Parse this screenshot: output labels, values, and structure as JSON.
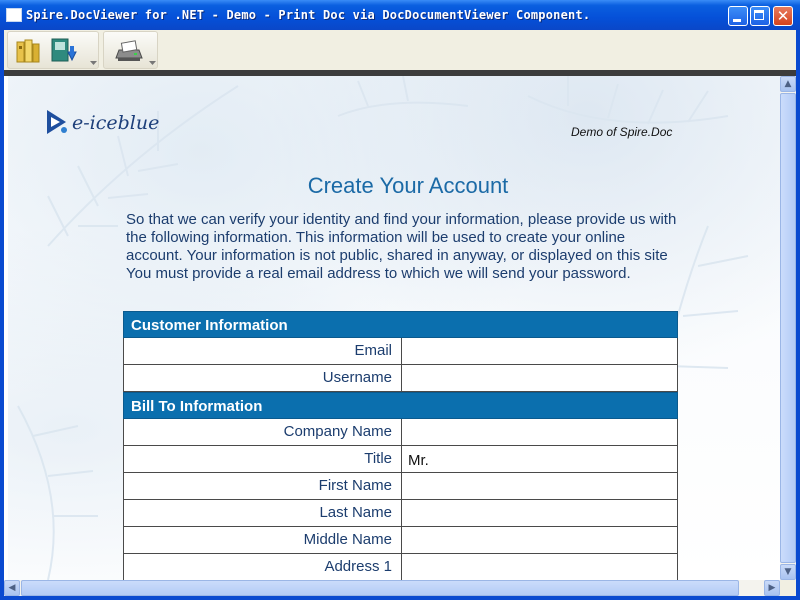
{
  "window": {
    "title": "Spire.DocViewer for .NET - Demo - Print Doc via DocDocumentViewer Component."
  },
  "toolbar": {
    "icons": [
      "open-file-icon",
      "save-icon",
      "print-icon"
    ]
  },
  "document": {
    "logo_text": "e-iceblue",
    "demo_caption": "Demo of Spire.Doc",
    "title": "Create Your Account",
    "intro_paragraph": "So that we can verify your identity and find your information, please provide us with the following information. This information will be used to create your online account. Your information is not public, shared in anyway, or displayed on this site",
    "email_note": "You must provide a real email address to which we will send your password.",
    "sections": [
      {
        "header": "Customer Information",
        "fields": [
          {
            "label": "Email",
            "value": ""
          },
          {
            "label": "Username",
            "value": ""
          }
        ]
      },
      {
        "header": "Bill To Information",
        "fields": [
          {
            "label": "Company Name",
            "value": ""
          },
          {
            "label": "Title",
            "value": "Mr."
          },
          {
            "label": "First Name",
            "value": ""
          },
          {
            "label": "Last Name",
            "value": ""
          },
          {
            "label": "Middle Name",
            "value": ""
          },
          {
            "label": "Address 1",
            "value": ""
          }
        ]
      }
    ]
  },
  "colors": {
    "section_header_bg": "#0b6fae",
    "title_color": "#1b6aa6",
    "body_text": "#1c3d6e"
  }
}
